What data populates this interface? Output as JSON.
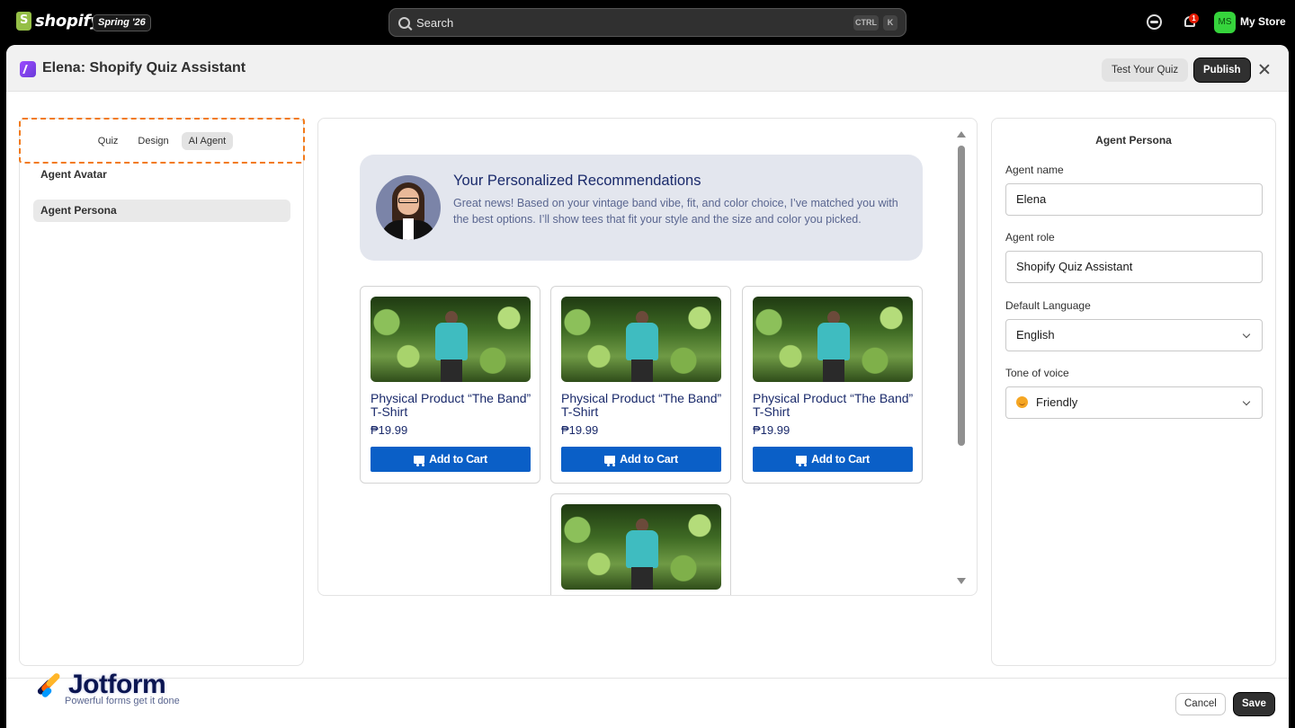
{
  "topbar": {
    "logo_text": "shopify",
    "badge": "Spring '26",
    "search_placeholder": "Search",
    "kbd_ctrl": "CTRL",
    "kbd_k": "K",
    "notification_count": "1",
    "store_initials": "MS",
    "store_name": "My Store"
  },
  "modal": {
    "title": "Elena: Shopify Quiz Assistant",
    "test_button": "Test Your Quiz",
    "publish_button": "Publish"
  },
  "left_panel": {
    "tabs": [
      {
        "label": "Quiz"
      },
      {
        "label": "Design"
      },
      {
        "label": "AI Agent"
      }
    ],
    "active_tab": "AI Agent",
    "nav": [
      {
        "label": "Agent Avatar"
      },
      {
        "label": "Agent Persona"
      }
    ],
    "active_nav": "Agent Persona"
  },
  "preview": {
    "rec_title": "Your Personalized Recommendations",
    "rec_text": "Great news! Based on your vintage band vibe, fit, and color choice, I’ve matched you with the best options. I’ll show tees that fit your style and the size and color you picked.",
    "products": [
      {
        "name": "Physical Product “The Band” T-Shirt",
        "price": "₱19.99",
        "button": "Add to Cart"
      },
      {
        "name": "Physical Product “The Band” T-Shirt",
        "price": "₱19.99",
        "button": "Add to Cart"
      },
      {
        "name": "Physical Product “The Band” T-Shirt",
        "price": "₱19.99",
        "button": "Add to Cart"
      }
    ]
  },
  "right_panel": {
    "title": "Agent Persona",
    "agent_name_label": "Agent name",
    "agent_name_value": "Elena",
    "agent_role_label": "Agent role",
    "agent_role_value": "Shopify Quiz Assistant",
    "language_label": "Default Language",
    "language_value": "English",
    "tone_label": "Tone of voice",
    "tone_value": "Friendly"
  },
  "footer": {
    "brand": "Jotform",
    "tagline": "Powerful forms get it done",
    "cancel_button": "Cancel",
    "save_button": "Save"
  },
  "colors": {
    "accent_dashed": "#f27a1a",
    "cart_button": "#0a5fc7",
    "store_avatar": "#36d43c"
  }
}
